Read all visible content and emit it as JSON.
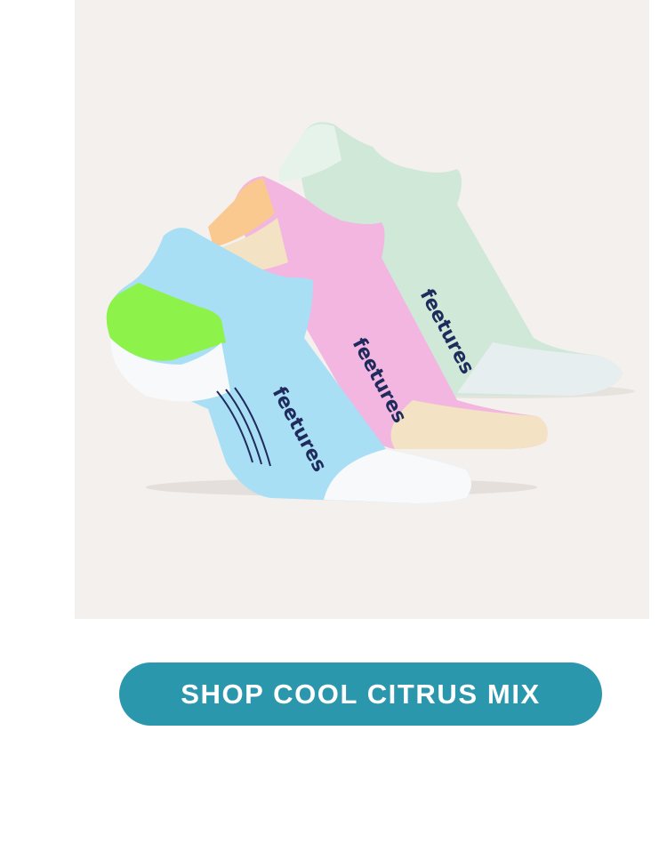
{
  "product_image": {
    "brand_mark": "feetures",
    "sock_colors": {
      "mint": "#cfe8d8",
      "pink": "#f2b6e0",
      "blue": "#a9dff5",
      "cream": "#f3e2c4",
      "peach": "#f9c98f",
      "lime": "#8df24a",
      "white": "#f8f9fb",
      "navy": "#1f2b5c"
    },
    "background_color": "#f4f0ed"
  },
  "cta": {
    "label": "SHOP COOL CITRUS MIX",
    "color": "#2b97ad"
  }
}
